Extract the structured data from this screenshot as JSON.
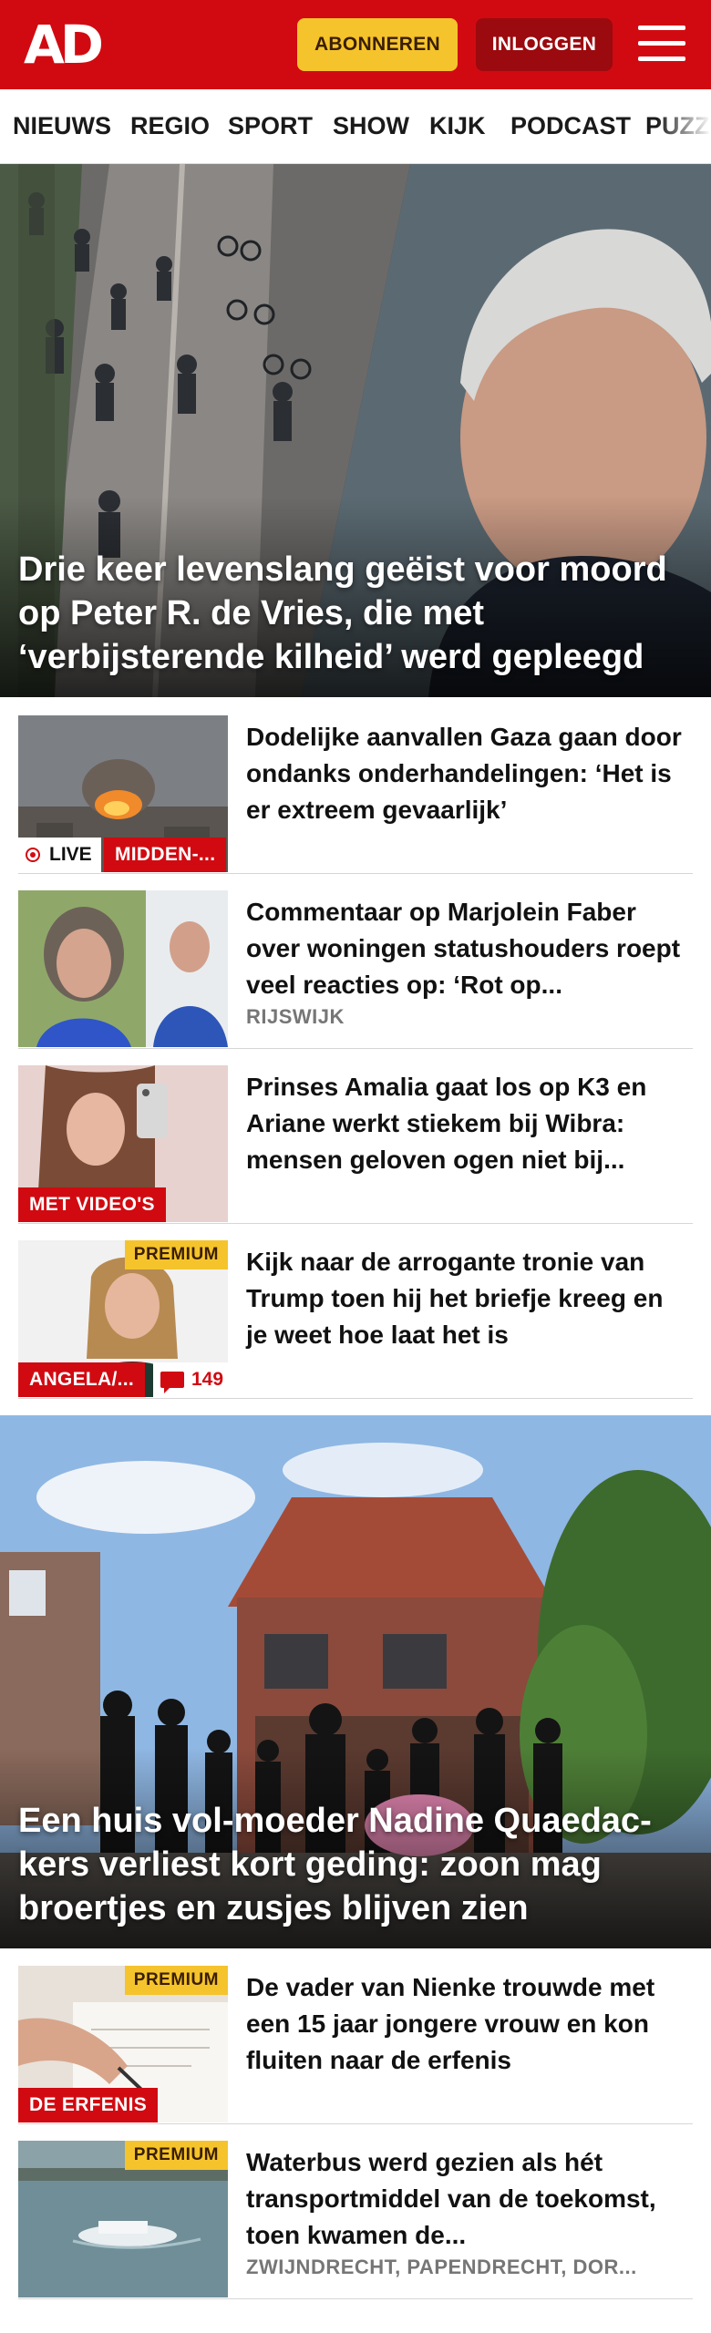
{
  "header": {
    "logo": "AD",
    "subscribe_label": "ABONNEREN",
    "login_label": "INLOGGEN",
    "menu_icon": "hamburger-menu-icon"
  },
  "nav": {
    "items": [
      "NIEUWS",
      "REGIO",
      "SPORT",
      "SHOW",
      "KIJK",
      "PODCAST",
      "PUZZELS"
    ]
  },
  "hero1": {
    "title": "Drie keer levenslang geëist voor moord op Peter R. de Vries, die met ‘verbijsterende kilheid’ werd gepleegd"
  },
  "articles1": [
    {
      "title": "Dodelijke aanvallen Gaza gaan door ondanks onderhandelingen: ‘Het is er extreem gevaarlijk’",
      "live_label": "LIVE",
      "category_label": "MIDDEN-..."
    },
    {
      "title": "Commentaar op Marjolein Faber over woningen statushouders roept veel reacties op: ‘Rot op...",
      "location": "RIJSWIJK"
    },
    {
      "title": "Prinses Amalia gaat los op K3 en Ariane werkt stiekem bij Wibra: mensen geloven ogen niet bij...",
      "category_label": "MET VIDEO'S"
    },
    {
      "title": "Kijk naar de arrogante tronie van Trump toen hij het briefje kreeg en je weet hoe laat het is",
      "premium_label": "PREMIUM",
      "category_label": "ANGELA/...",
      "comment_count": "149"
    }
  ],
  "hero2": {
    "title": "Een huis vol-moeder Nadine Quaedac-kers verliest kort geding: zoon mag broertjes en zusjes blijven zien"
  },
  "articles2": [
    {
      "title": "De vader van Nienke trouwde met een 15 jaar jongere vrouw en kon fluiten naar de erfenis",
      "premium_label": "PREMIUM",
      "category_label": "DE ERFENIS"
    },
    {
      "title": "Waterbus werd gezien als hét transportmiddel van de toekomst, toen kwamen de...",
      "premium_label": "PREMIUM",
      "location": "ZWIJNDRECHT, PAPENDRECHT, DOR..."
    }
  ],
  "colors": {
    "brand_red": "#d10a11",
    "premium_yellow": "#f5c42c",
    "login_dark_red": "#9b0a0e"
  }
}
